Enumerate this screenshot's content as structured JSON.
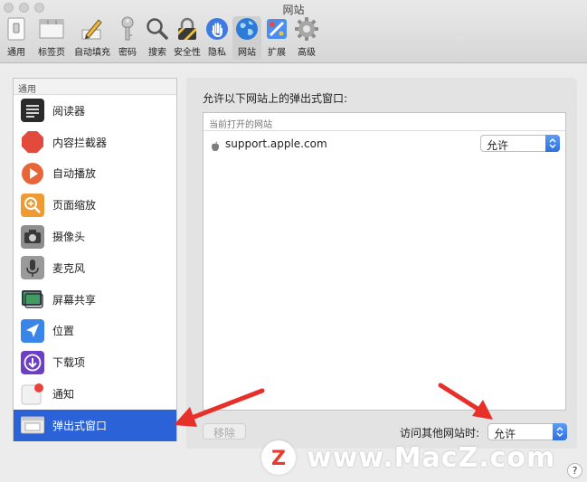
{
  "window": {
    "title": "网站"
  },
  "toolbar": {
    "items": [
      {
        "label": "通用",
        "icon": "switch-icon"
      },
      {
        "label": "标签页",
        "icon": "tabs-icon"
      },
      {
        "label": "自动填充",
        "icon": "pencil-icon"
      },
      {
        "label": "密码",
        "icon": "key-icon"
      },
      {
        "label": "搜索",
        "icon": "magnifier-icon"
      },
      {
        "label": "安全性",
        "icon": "padlock-icon"
      },
      {
        "label": "隐私",
        "icon": "hand-icon"
      },
      {
        "label": "网站",
        "icon": "globe-icon",
        "active": true
      },
      {
        "label": "扩展",
        "icon": "puzzle-icon"
      },
      {
        "label": "高级",
        "icon": "gear-icon"
      }
    ]
  },
  "sidebar": {
    "section": "通用",
    "items": [
      {
        "label": "阅读器",
        "icon": "reader-icon"
      },
      {
        "label": "内容拦截器",
        "icon": "stop-icon"
      },
      {
        "label": "自动播放",
        "icon": "play-icon"
      },
      {
        "label": "页面缩放",
        "icon": "zoom-icon"
      },
      {
        "label": "摄像头",
        "icon": "camera-icon"
      },
      {
        "label": "麦克风",
        "icon": "microphone-icon"
      },
      {
        "label": "屏幕共享",
        "icon": "screen-share-icon"
      },
      {
        "label": "位置",
        "icon": "location-icon"
      },
      {
        "label": "下载项",
        "icon": "download-icon"
      },
      {
        "label": "通知",
        "icon": "notification-icon"
      },
      {
        "label": "弹出式窗口",
        "icon": "popup-window-icon",
        "selected": true
      }
    ]
  },
  "main": {
    "title": "允许以下网站上的弹出式窗口:",
    "table_header": "当前打开的网站",
    "sites": [
      {
        "name": "support.apple.com",
        "setting": "允许"
      }
    ],
    "remove_label": "移除",
    "other_label": "访问其他网站时:",
    "other_setting": "允许"
  },
  "watermark": {
    "text": "www.MacZ.com",
    "logo_letter": "Z"
  },
  "help": "?",
  "colors": {
    "selection": "#2b62d7",
    "arrow": "#e8302a",
    "stepper": "#2e70e0"
  }
}
